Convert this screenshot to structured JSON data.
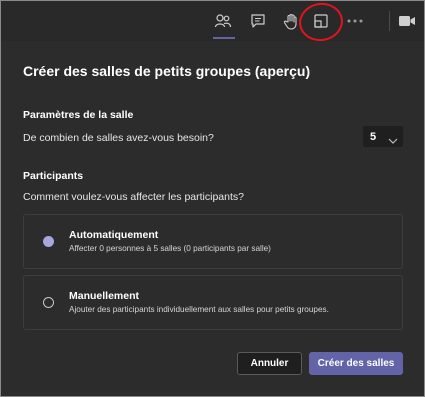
{
  "toolbar": {
    "icons": [
      "participants-icon",
      "chat-icon",
      "raise-hand-icon",
      "breakout-rooms-icon",
      "more-options-icon",
      "video-icon"
    ]
  },
  "dialog": {
    "title": "Créer des salles de petits groupes (aperçu)",
    "room_settings": {
      "heading": "Paramètres de la salle",
      "question": "De combien de salles avez-vous besoin?",
      "room_count": "5"
    },
    "participants": {
      "heading": "Participants",
      "question": "Comment voulez-vous affecter les participants?",
      "options": [
        {
          "title": "Automatiquement",
          "description": "Affecter 0 personnes à 5 salles (0 participants par salle)",
          "selected": true
        },
        {
          "title": "Manuellement",
          "description": "Ajouter des participants individuellement aux salles pour petits groupes.",
          "selected": false
        }
      ]
    },
    "buttons": {
      "cancel": "Annuler",
      "create": "Créer des salles"
    }
  },
  "colors": {
    "accent": "#6264a7",
    "annotation": "#e0141e"
  }
}
